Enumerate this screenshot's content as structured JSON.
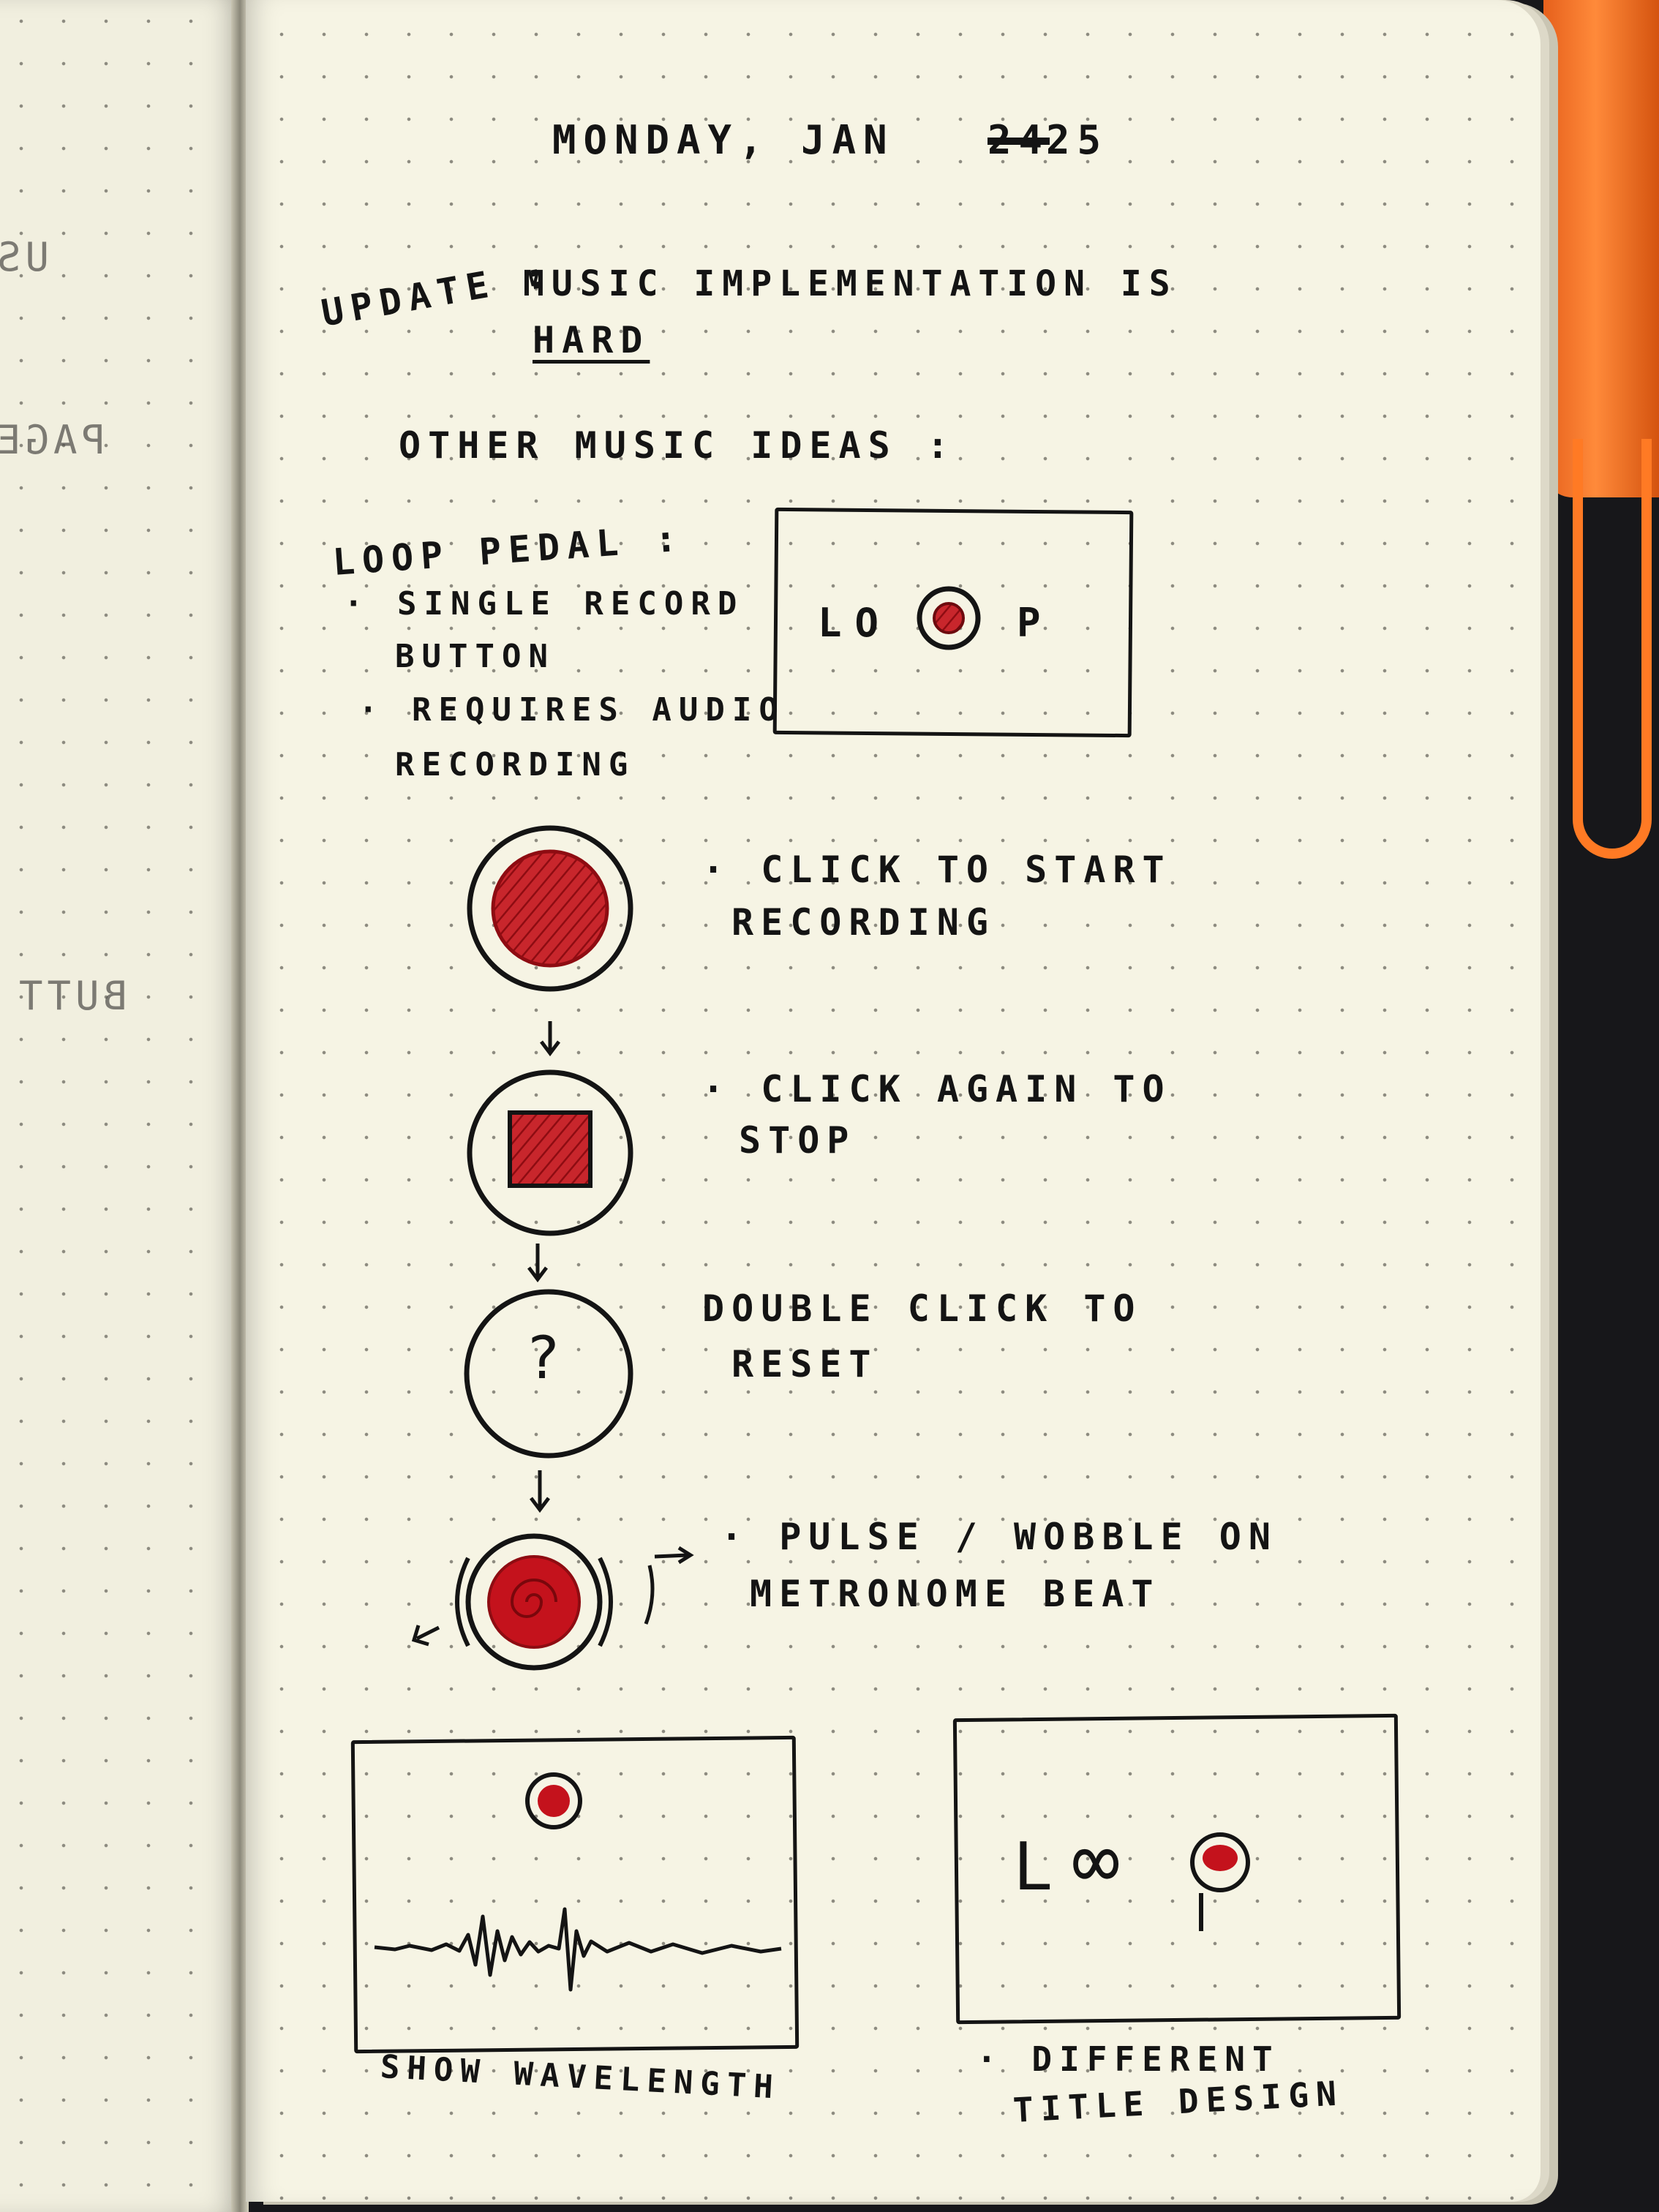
{
  "date": "MONDAY, JAN",
  "date_crossed": "24",
  "date_day": "25",
  "update_label": "UPDATE :",
  "update_text_1": "MUSIC IMPLEMENTATION IS",
  "update_text_2": "HARD",
  "other_ideas": "OTHER MUSIC IDEAS :",
  "loop_pedal": {
    "heading": "LOOP PEDAL :",
    "bullet1_a": "· SINGLE RECORD",
    "bullet1_b": "BUTTON",
    "bullet2_a": "· REQUIRES AUDIO",
    "bullet2_b": "RECORDING"
  },
  "title_sketch": {
    "left": "LO",
    "right": "P"
  },
  "steps": [
    {
      "line1": "· CLICK TO START",
      "line2": "RECORDING"
    },
    {
      "line1": "· CLICK AGAIN TO",
      "line2": "STOP"
    },
    {
      "line1": "DOUBLE CLICK TO",
      "line2": "RESET",
      "symbol": "?"
    },
    {
      "line1": "· PULSE / WOBBLE ON",
      "line2": "METRONOME BEAT"
    }
  ],
  "wave_caption": "SHOW WAVELENGTH",
  "title_caption_1": "· DIFFERENT",
  "title_caption_2": "TITLE DESIGN",
  "title2_sketch": {
    "left": "L",
    "infinity": "∞"
  },
  "left_page_fragments": [
    "US",
    "PAGE",
    "BUTT"
  ],
  "colors": {
    "ink": "#141414",
    "red_ink": "#b3131b",
    "paper": "#f6f4e4",
    "marker": "#ff7a24"
  }
}
